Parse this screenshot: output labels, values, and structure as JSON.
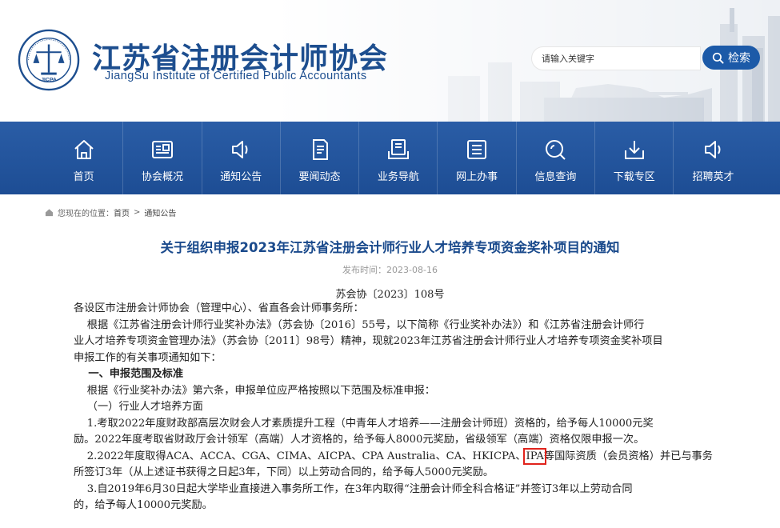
{
  "header": {
    "logo_alt": "JICPA",
    "title": "江苏省注册会计师协会",
    "subtitle": "JiangSu Institute of Certified Public Accountants",
    "search": {
      "placeholder": "请输入关键字",
      "button_label": "检索"
    }
  },
  "nav": {
    "items": [
      {
        "label": "首页",
        "icon": "home-icon"
      },
      {
        "label": "协会概况",
        "icon": "profile-card-icon"
      },
      {
        "label": "通知公告",
        "icon": "speaker-icon"
      },
      {
        "label": "要闻动态",
        "icon": "document-icon"
      },
      {
        "label": "业务导航",
        "icon": "reader-icon"
      },
      {
        "label": "网上办事",
        "icon": "list-icon"
      },
      {
        "label": "信息查询",
        "icon": "search-icon"
      },
      {
        "label": "下载专区",
        "icon": "download-icon"
      },
      {
        "label": "招聘英才",
        "icon": "speaker-icon"
      }
    ]
  },
  "breadcrumb": {
    "prefix": "您现在的位置：",
    "home": "首页",
    "separator": ">",
    "current": "通知公告"
  },
  "article": {
    "title": "关于组织申报2023年江苏省注册会计师行业人才培养专项资金奖补项目的通知",
    "date_label": "发布时间：",
    "date": "2023-08-16",
    "doc_number": "苏会协〔2023〕108号",
    "lines": [
      "各设区市注册会计师协会（管理中心）、省直各会计师事务所：",
      "    根据《江苏省注册会计师行业奖补办法》（苏会协〔2016〕55号，以下简称《行业奖补办法》）和《江苏省注册会计师行",
      "业人才培养专项资金管理办法》（苏会协〔2011〕98号）精神，现就2023年江苏省注册会计师行业人才培养专项资金奖补项目",
      "申报工作的有关事项通知如下：",
      "    一、申报范围及标准",
      "    根据《行业奖补办法》第六条，申报单位应严格按照以下范围及标准申报：",
      "    （一）行业人才培养方面",
      "    1.考取2022年度财政部高层次财会人才素质提升工程（中青年人才培养——注册会计师班）资格的，给予每人10000元奖",
      "励。2022年度考取省财政厅会计领军（高端）人才资格的，给予每人8000元奖励，省级领军（高端）资格仅限申报一次。",
      "    2.2022年度取得ACA、ACCA、CGA、CIMA、AICPA、CPA Australia、CA、HKICPA、",
      "IPA",
      "等国际资质（会员资格）并已与事务",
      "所签订3年（从上述证书获得之日起3年，下同）以上劳动合同的，给予每人5000元奖励。",
      "    3.自2019年6月30日起大学毕业直接进入事务所工作，在3年内取得“注册会计师全科合格证”并签订3年以上劳动合同",
      "的，给予每人10000元奖励。"
    ]
  },
  "colors": {
    "brand_blue": "#1d4e8f",
    "nav_blue": "#2a5da6",
    "highlight_red": "#e0231c"
  }
}
